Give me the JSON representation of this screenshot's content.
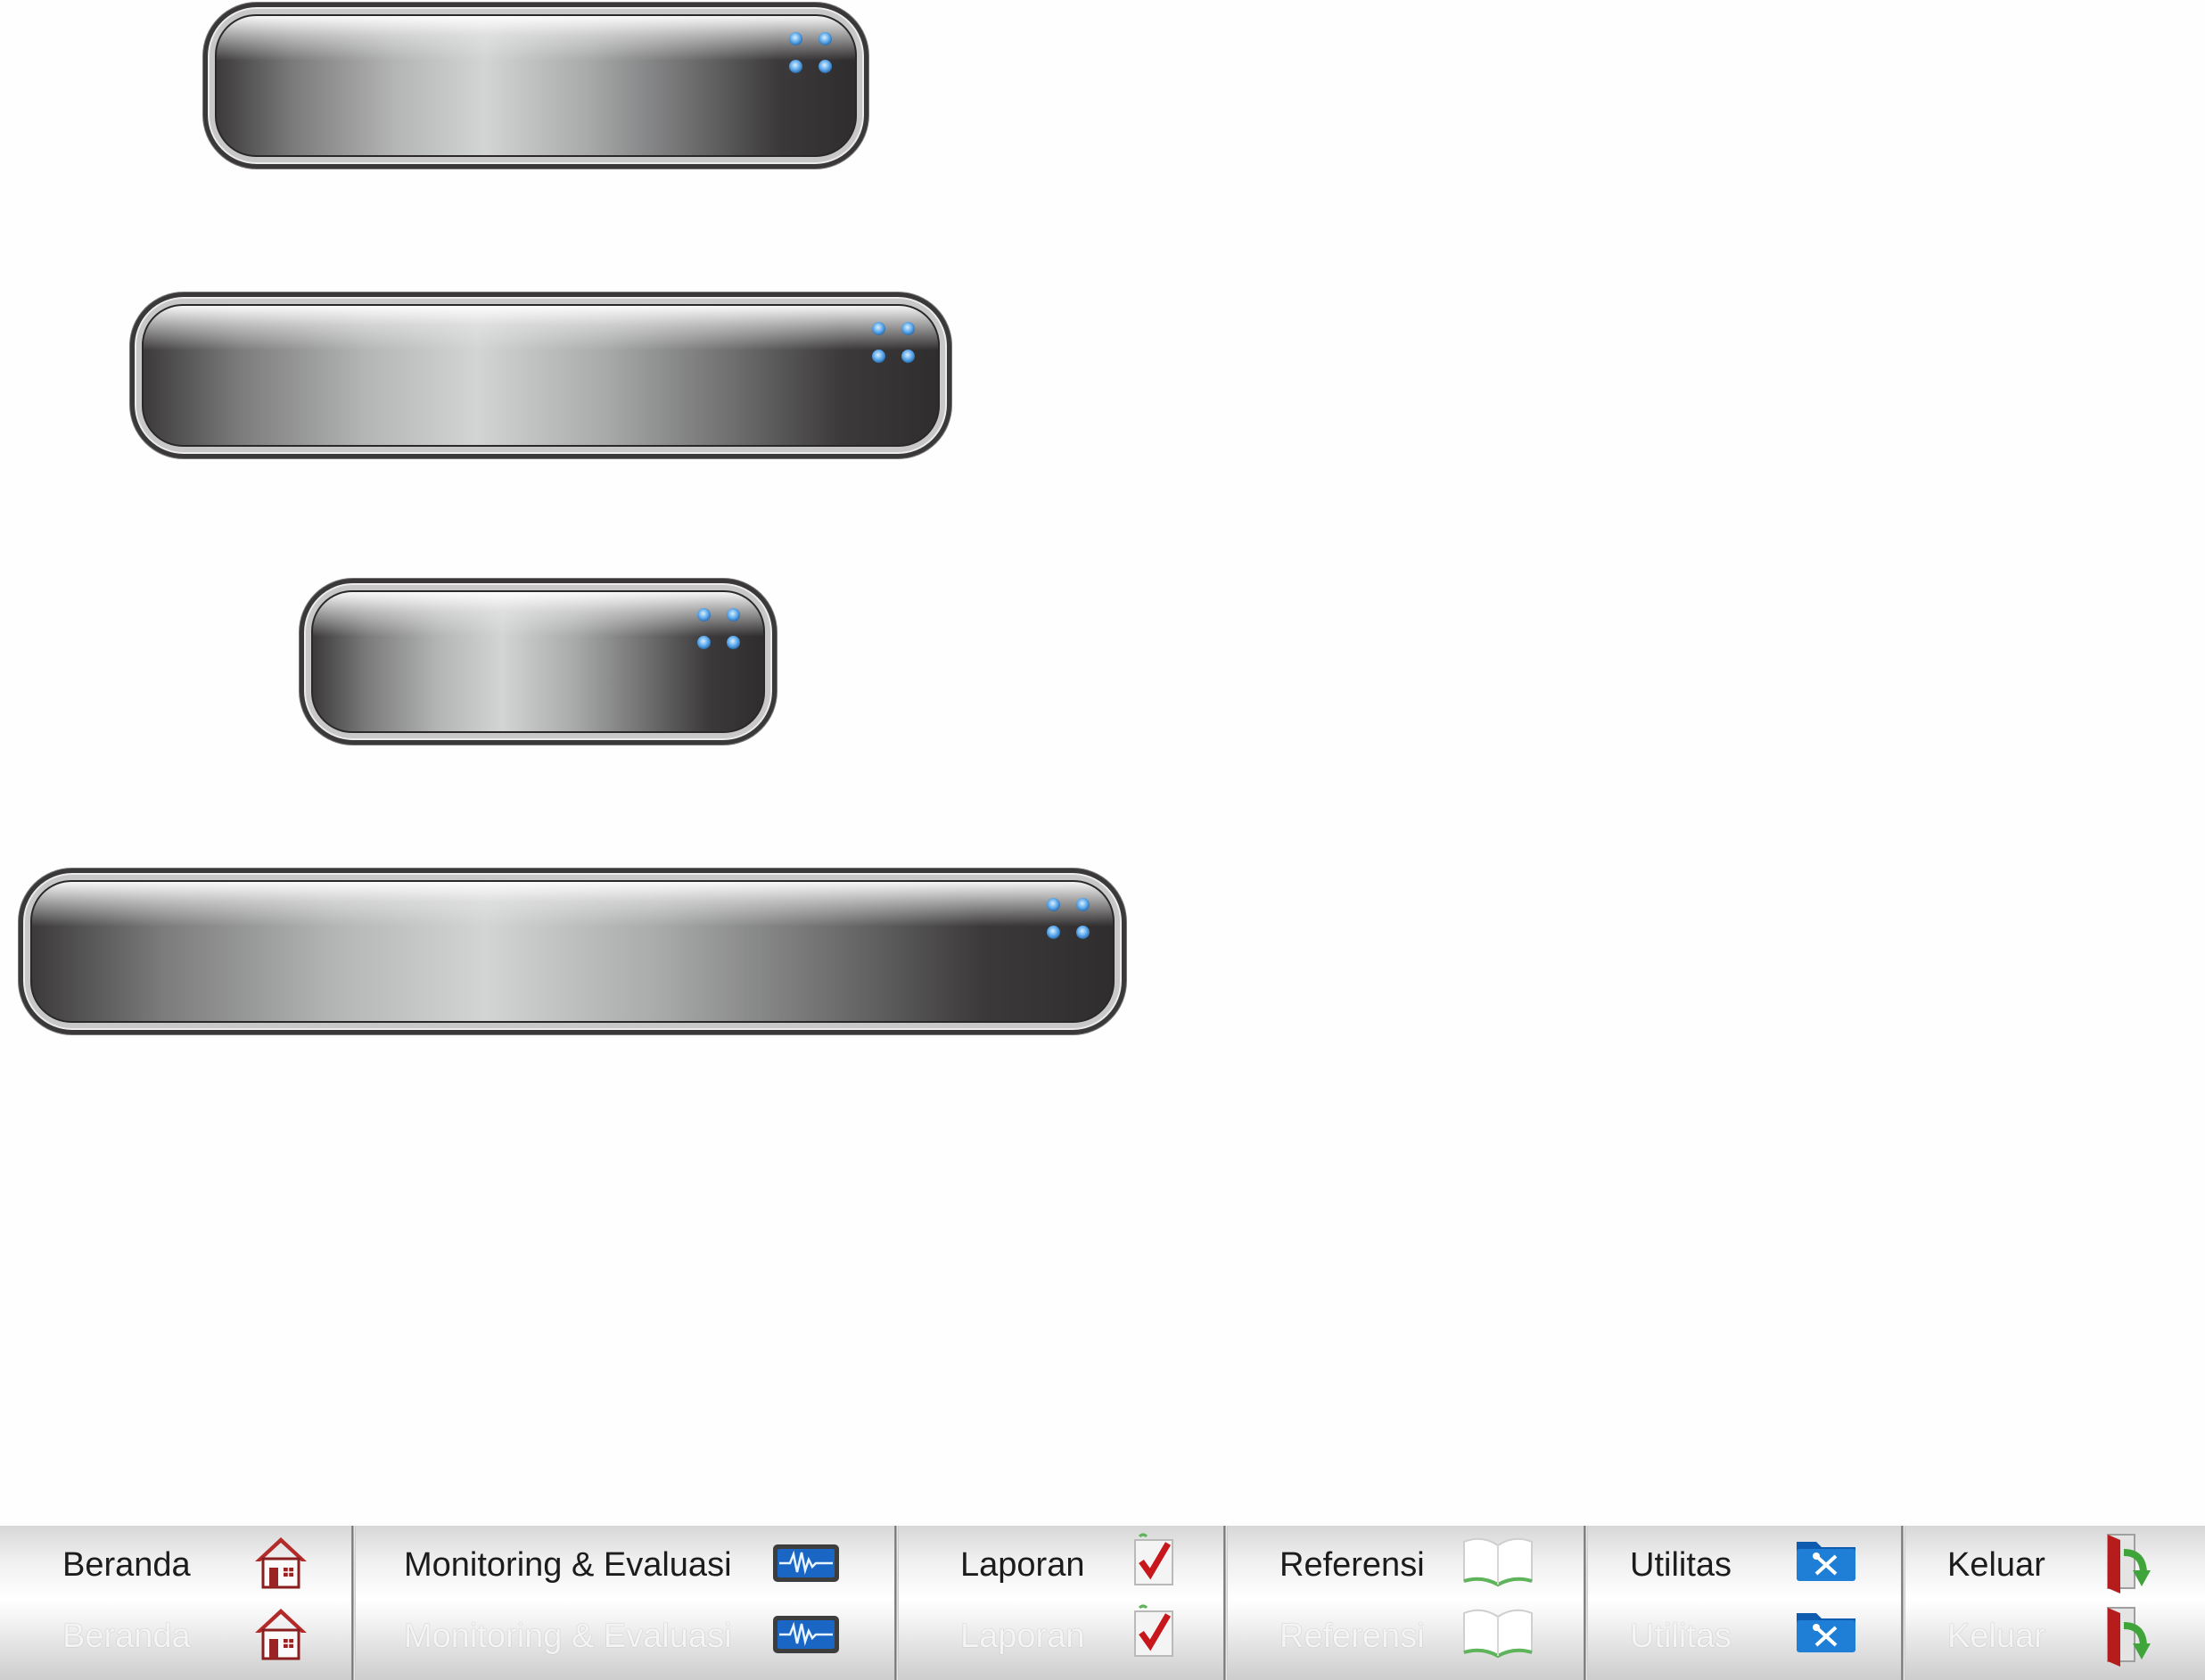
{
  "glossy_buttons": [
    {
      "label": ""
    },
    {
      "label": ""
    },
    {
      "label": ""
    },
    {
      "label": ""
    }
  ],
  "menu": {
    "items": [
      {
        "label": "Beranda",
        "icon": "home-icon"
      },
      {
        "label": "Monitoring & Evaluasi",
        "icon": "monitor-pulse-icon"
      },
      {
        "label": "Laporan",
        "icon": "checkbox-check-icon"
      },
      {
        "label": "Referensi",
        "icon": "open-book-icon"
      },
      {
        "label": "Utilitas",
        "icon": "tools-folder-icon"
      },
      {
        "label": "Keluar",
        "icon": "exit-door-icon"
      }
    ]
  },
  "colors": {
    "dot_blue": "#5aa6ea",
    "home_red": "#b22a2a",
    "check_red": "#c8161d",
    "folder_blue": "#1f7fd6",
    "book_green": "#5fb35a",
    "exit_green": "#3fa53a"
  }
}
